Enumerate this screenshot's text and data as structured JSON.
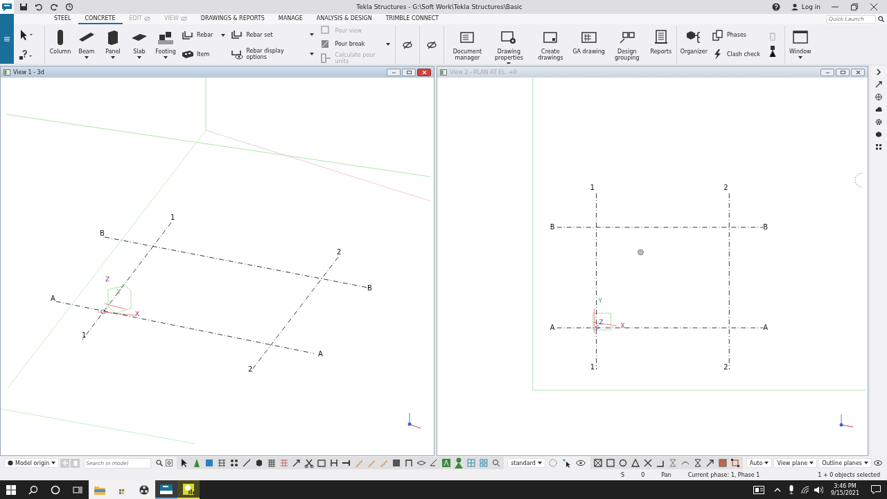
{
  "window": {
    "title": "Tekla Structures - G:\\Soft Work\\Tekla Structures\\Basic",
    "login": "Log in"
  },
  "tabs": [
    {
      "label": "STEEL",
      "selected": false,
      "disabled": false
    },
    {
      "label": "CONCRETE",
      "selected": true,
      "disabled": false
    },
    {
      "label": "EDIT",
      "selected": false,
      "disabled": true
    },
    {
      "label": "VIEW",
      "selected": false,
      "disabled": true
    },
    {
      "label": "DRAWINGS & REPORTS",
      "selected": false,
      "disabled": false
    },
    {
      "label": "MANAGE",
      "selected": false,
      "disabled": false
    },
    {
      "label": "ANALYSIS & DESIGN",
      "selected": false,
      "disabled": false
    },
    {
      "label": "TRIMBLE CONNECT",
      "selected": false,
      "disabled": false
    }
  ],
  "quick_launch": {
    "placeholder": "Quick Launch"
  },
  "ribbon_groups": [
    {
      "items": [
        {
          "kind": "tools"
        }
      ]
    },
    {
      "items": [
        {
          "kind": "large",
          "label": "Column",
          "dropdown": false
        },
        {
          "kind": "large",
          "label": "Beam",
          "dropdown": true
        },
        {
          "kind": "large",
          "label": "Panel",
          "dropdown": true
        },
        {
          "kind": "large",
          "label": "Slab",
          "dropdown": true
        },
        {
          "kind": "large",
          "label": "Footing",
          "dropdown": true
        },
        {
          "kind": "stack",
          "items": [
            {
              "label": "Rebar",
              "disabled": false,
              "dropdown": true
            },
            {
              "label": "Item",
              "disabled": false,
              "dropdown": false
            }
          ]
        },
        {
          "kind": "stack",
          "items": [
            {
              "label": "Rebar set",
              "disabled": false,
              "dropdown": true
            },
            {
              "label": "Rebar display options",
              "disabled": false,
              "dropdown": true
            }
          ]
        },
        {
          "kind": "stack",
          "items": [
            {
              "label": "Pour view",
              "disabled": true,
              "dropdown": false
            },
            {
              "label": "Pour break",
              "disabled": false,
              "dropdown": true
            },
            {
              "label": "Calculate pour units",
              "disabled": true,
              "dropdown": false
            }
          ]
        }
      ]
    },
    {
      "items": [
        {
          "kind": "icon"
        }
      ]
    },
    {
      "items": [
        {
          "kind": "icon"
        }
      ]
    },
    {
      "items": [
        {
          "kind": "large",
          "label": "Document manager",
          "dropdown": false
        },
        {
          "kind": "large",
          "label": "Drawing properties",
          "dropdown": true
        },
        {
          "kind": "large",
          "label": "Create drawings",
          "dropdown": false
        },
        {
          "kind": "large",
          "label": "GA drawing",
          "dropdown": false
        },
        {
          "kind": "large",
          "label": "Design grouping",
          "dropdown": false
        },
        {
          "kind": "large",
          "label": "Reports",
          "dropdown": false
        }
      ]
    },
    {
      "items": [
        {
          "kind": "large",
          "label": "Organizer",
          "dropdown": false
        },
        {
          "kind": "stack",
          "items": [
            {
              "label": "Phases",
              "disabled": false,
              "dropdown": false
            },
            {
              "label": "Clash check",
              "disabled": false,
              "dropdown": false
            }
          ]
        },
        {
          "kind": "icon"
        }
      ]
    },
    {
      "items": [
        {
          "kind": "large",
          "label": "Window",
          "dropdown": true
        }
      ]
    }
  ],
  "views": [
    {
      "title": "View 1 - 3d",
      "active": true,
      "grid_labels": [
        "1",
        "B",
        "2",
        "B",
        "A",
        "1",
        "A",
        "2"
      ],
      "axis_labels": [
        "Z",
        "Y",
        "X"
      ]
    },
    {
      "title": "View 2 - PLAN AT EL. +0",
      "active": false,
      "grid_labels": [
        "1",
        "2",
        "B",
        "B",
        "A",
        "A",
        "1",
        "2"
      ],
      "axis_labels": [
        "Y",
        "Z",
        "X"
      ]
    }
  ],
  "toolbar": {
    "origin": "Model origin",
    "search_placeholder": "Search in model",
    "display": "standard",
    "dropdowns": [
      "Auto",
      "View plane",
      "Outline planes"
    ]
  },
  "status_bar": {
    "fields": [
      "S",
      "0",
      "Pan",
      "Current phase: 1, Phase 1",
      "1 + 0 objects selected"
    ]
  },
  "taskbar": {
    "time": "3:46 PM",
    "date": "9/15/2021"
  }
}
